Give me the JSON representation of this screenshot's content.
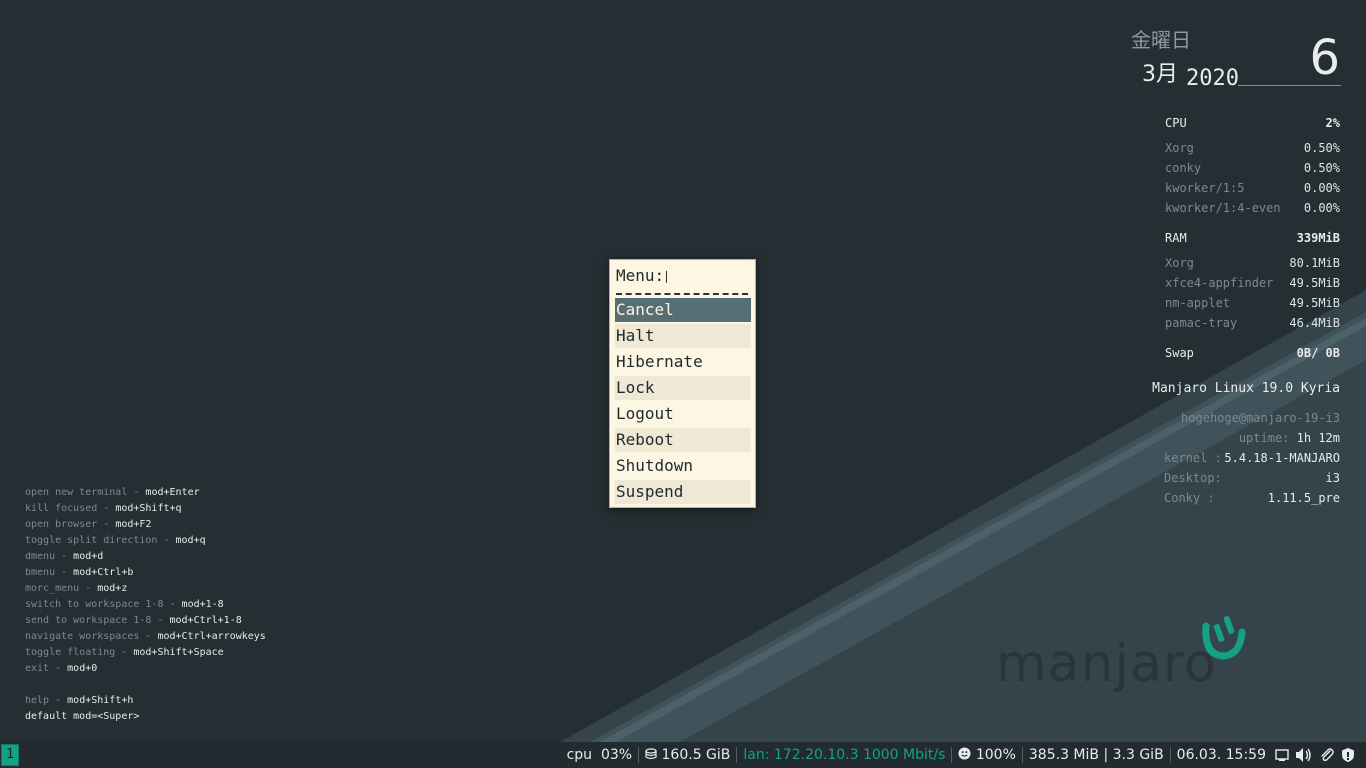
{
  "conky": {
    "weekday": "金曜日",
    "month": "3月",
    "year": "2020",
    "day": "6",
    "cpu": {
      "label": "CPU",
      "total": "2%",
      "procs": [
        {
          "name": "Xorg",
          "value": "0.50%"
        },
        {
          "name": "conky",
          "value": "0.50%"
        },
        {
          "name": "kworker/1:5",
          "value": "0.00%"
        },
        {
          "name": "kworker/1:4-even",
          "value": "0.00%"
        }
      ]
    },
    "ram": {
      "label": "RAM",
      "total": "339MiB",
      "procs": [
        {
          "name": "Xorg",
          "value": "80.1MiB"
        },
        {
          "name": "xfce4-appfinder",
          "value": "49.5MiB"
        },
        {
          "name": "nm-applet",
          "value": "49.5MiB"
        },
        {
          "name": "pamac-tray",
          "value": "46.4MiB"
        }
      ]
    },
    "swap": {
      "label": "Swap",
      "value": "0B/ 0B"
    },
    "system_name": "Manjaro Linux 19.0 Kyria",
    "user_host": "hogehoge@manjaro-19-i3",
    "uptime": {
      "label": "uptime:",
      "value": "1h 12m"
    },
    "kernel": {
      "label": "kernel :",
      "value": "5.4.18-1-MANJARO"
    },
    "desktop": {
      "label": "Desktop:",
      "value": "i3"
    },
    "conky_ver": {
      "label": "Conky  :",
      "value": "1.11.5_pre"
    }
  },
  "keybindings": [
    {
      "desc": "open new terminal",
      "keys": "mod+Enter"
    },
    {
      "desc": "kill focused",
      "keys": "mod+Shift+q"
    },
    {
      "desc": "open browser",
      "keys": "mod+F2"
    },
    {
      "desc": "toggle split direction",
      "keys": "mod+q"
    },
    {
      "desc": "dmenu",
      "keys": "mod+d"
    },
    {
      "desc": "bmenu",
      "keys": "mod+Ctrl+b"
    },
    {
      "desc": "morc_menu",
      "keys": "mod+z"
    },
    {
      "desc": "switch to workspace 1-8",
      "keys": "mod+1-8"
    },
    {
      "desc": "send to workspace 1-8",
      "keys": "mod+Ctrl+1-8"
    },
    {
      "desc": "navigate workspaces",
      "keys": "mod+Ctrl+arrowkeys"
    },
    {
      "desc": "toggle floating",
      "keys": "mod+Shift+Space"
    },
    {
      "desc": "exit",
      "keys": "mod+0"
    },
    {
      "desc": "",
      "keys": ""
    },
    {
      "desc": "help",
      "keys": "mod+Shift+h"
    },
    {
      "desc": "",
      "keys": "default mod=<Super>"
    }
  ],
  "logo": {
    "text": "manjaro"
  },
  "menu": {
    "prompt": "Menu:",
    "items": [
      "Cancel",
      "Halt",
      "Hibernate",
      "Lock",
      "Logout",
      "Reboot",
      "Shutdown",
      "Suspend"
    ],
    "selected": "Cancel"
  },
  "bar": {
    "workspace": "1",
    "cpu_label": "cpu",
    "cpu_value": "03%",
    "disk": "160.5 GiB",
    "lan": "lan: 172.20.10.3 1000 Mbit/s",
    "battery": "100%",
    "memory": "385.3 MiB | 3.3 GiB",
    "datetime": "06.03. 15:59",
    "icons": [
      "window-icon",
      "volume-icon",
      "paperclip-icon",
      "shield-icon"
    ]
  },
  "colors": {
    "desktop": "#252e33",
    "accent": "#16a085",
    "menu_bg": "#fdf6e3",
    "menu_selected": "#586e75"
  }
}
